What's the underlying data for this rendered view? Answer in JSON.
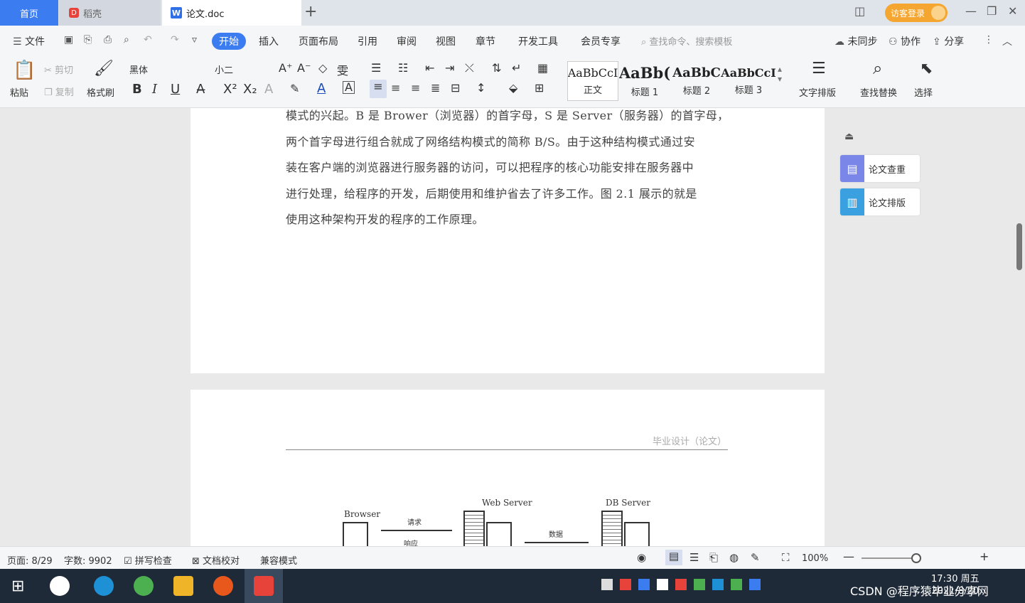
{
  "tabs": {
    "home": "首页",
    "daoke": "稻壳",
    "doc": "论文.doc",
    "add": "+"
  },
  "login": "访客登录",
  "menu": {
    "file": "文件",
    "start": "开始",
    "insert": "插入",
    "layout": "页面布局",
    "reference": "引用",
    "review": "审阅",
    "view": "视图",
    "chapter": "章节",
    "devtools": "开发工具",
    "member": "会员专享",
    "search": "查找命令、搜索模板",
    "sync": "未同步",
    "collab": "协作",
    "share": "分享"
  },
  "ribbon": {
    "paste": "粘贴",
    "cut": "剪切",
    "copy": "复制",
    "format_painter": "格式刷",
    "font": "黑体",
    "size": "小二",
    "styles": [
      {
        "sample": "AaBbCcI",
        "label": "正文"
      },
      {
        "sample": "AaBb(",
        "label": "标题 1"
      },
      {
        "sample": "AaBbC",
        "label": "标题 2"
      },
      {
        "sample": "AaBbCcI",
        "label": "标题 3"
      }
    ],
    "text_layout": "文字排版",
    "find_replace": "查找替换",
    "select": "选择"
  },
  "document": {
    "lines": [
      "模式的兴起。B 是 Brower（浏览器）的首字母，S 是 Server（服务器）的首字母，",
      "两个首字母进行组合就成了网络结构模式的简称 B/S。由于这种结构模式通过安",
      "装在客户端的浏览器进行服务器的访问，可以把程序的核心功能安排在服务器中",
      "进行处理，给程序的开发，后期使用和维护省去了许多工作。图 2.1 展示的就是",
      "使用这种架构开发的程序的工作原理。"
    ],
    "page2_header": "毕业设计（论文）",
    "diagram": {
      "browser": "Browser",
      "web_server": "Web Server",
      "db_server": "DB Server",
      "req": "请求",
      "resp": "响应",
      "data": "数据"
    }
  },
  "right_panel": {
    "check": "论文查重",
    "layout": "论文排版"
  },
  "status": {
    "page": "页面: 8/29",
    "words": "字数: 9902",
    "spell": "拼写检查",
    "proof": "文档校对",
    "compat": "兼容模式",
    "zoom": "100%"
  },
  "taskbar": {
    "time": "17:30 周五",
    "date": "2021/8/20",
    "watermark": "CSDN @程序猿毕业分享网"
  },
  "colors": {
    "accent": "#3c7cf1",
    "login": "#f5a630",
    "taskbar": "#1f2a38"
  }
}
